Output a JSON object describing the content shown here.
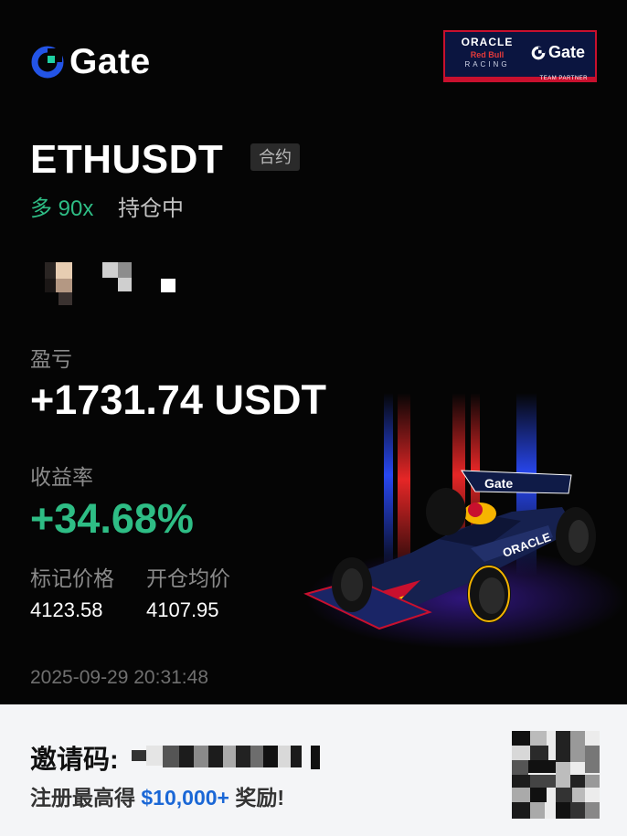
{
  "brand": {
    "name": "Gate"
  },
  "sponsor": {
    "line1": "ORACLE",
    "line2": "Red Bull",
    "line3": "RACING",
    "gate": "Gate",
    "partner": "TEAM PARTNER"
  },
  "position": {
    "pair": "ETHUSDT",
    "tag": "合约",
    "direction": "多 90x",
    "status": "持仓中"
  },
  "pnl": {
    "label": "盈亏",
    "value": "+1731.74 USDT"
  },
  "roe": {
    "label": "收益率",
    "value": "+34.68%"
  },
  "prices": {
    "mark_label": "标记价格",
    "mark_value": "4123.58",
    "entry_label": "开仓均价",
    "entry_value": "4107.95"
  },
  "timestamp": "2025-09-29 20:31:48",
  "footer": {
    "invite_label": "邀请码:",
    "promo_prefix": "注册最高得 ",
    "promo_amount": "$10,000+",
    "promo_suffix": " 奖励!"
  },
  "colors": {
    "up": "#2ebd85",
    "brand_blue": "#2354e6",
    "promo_blue": "#1a67d6"
  }
}
